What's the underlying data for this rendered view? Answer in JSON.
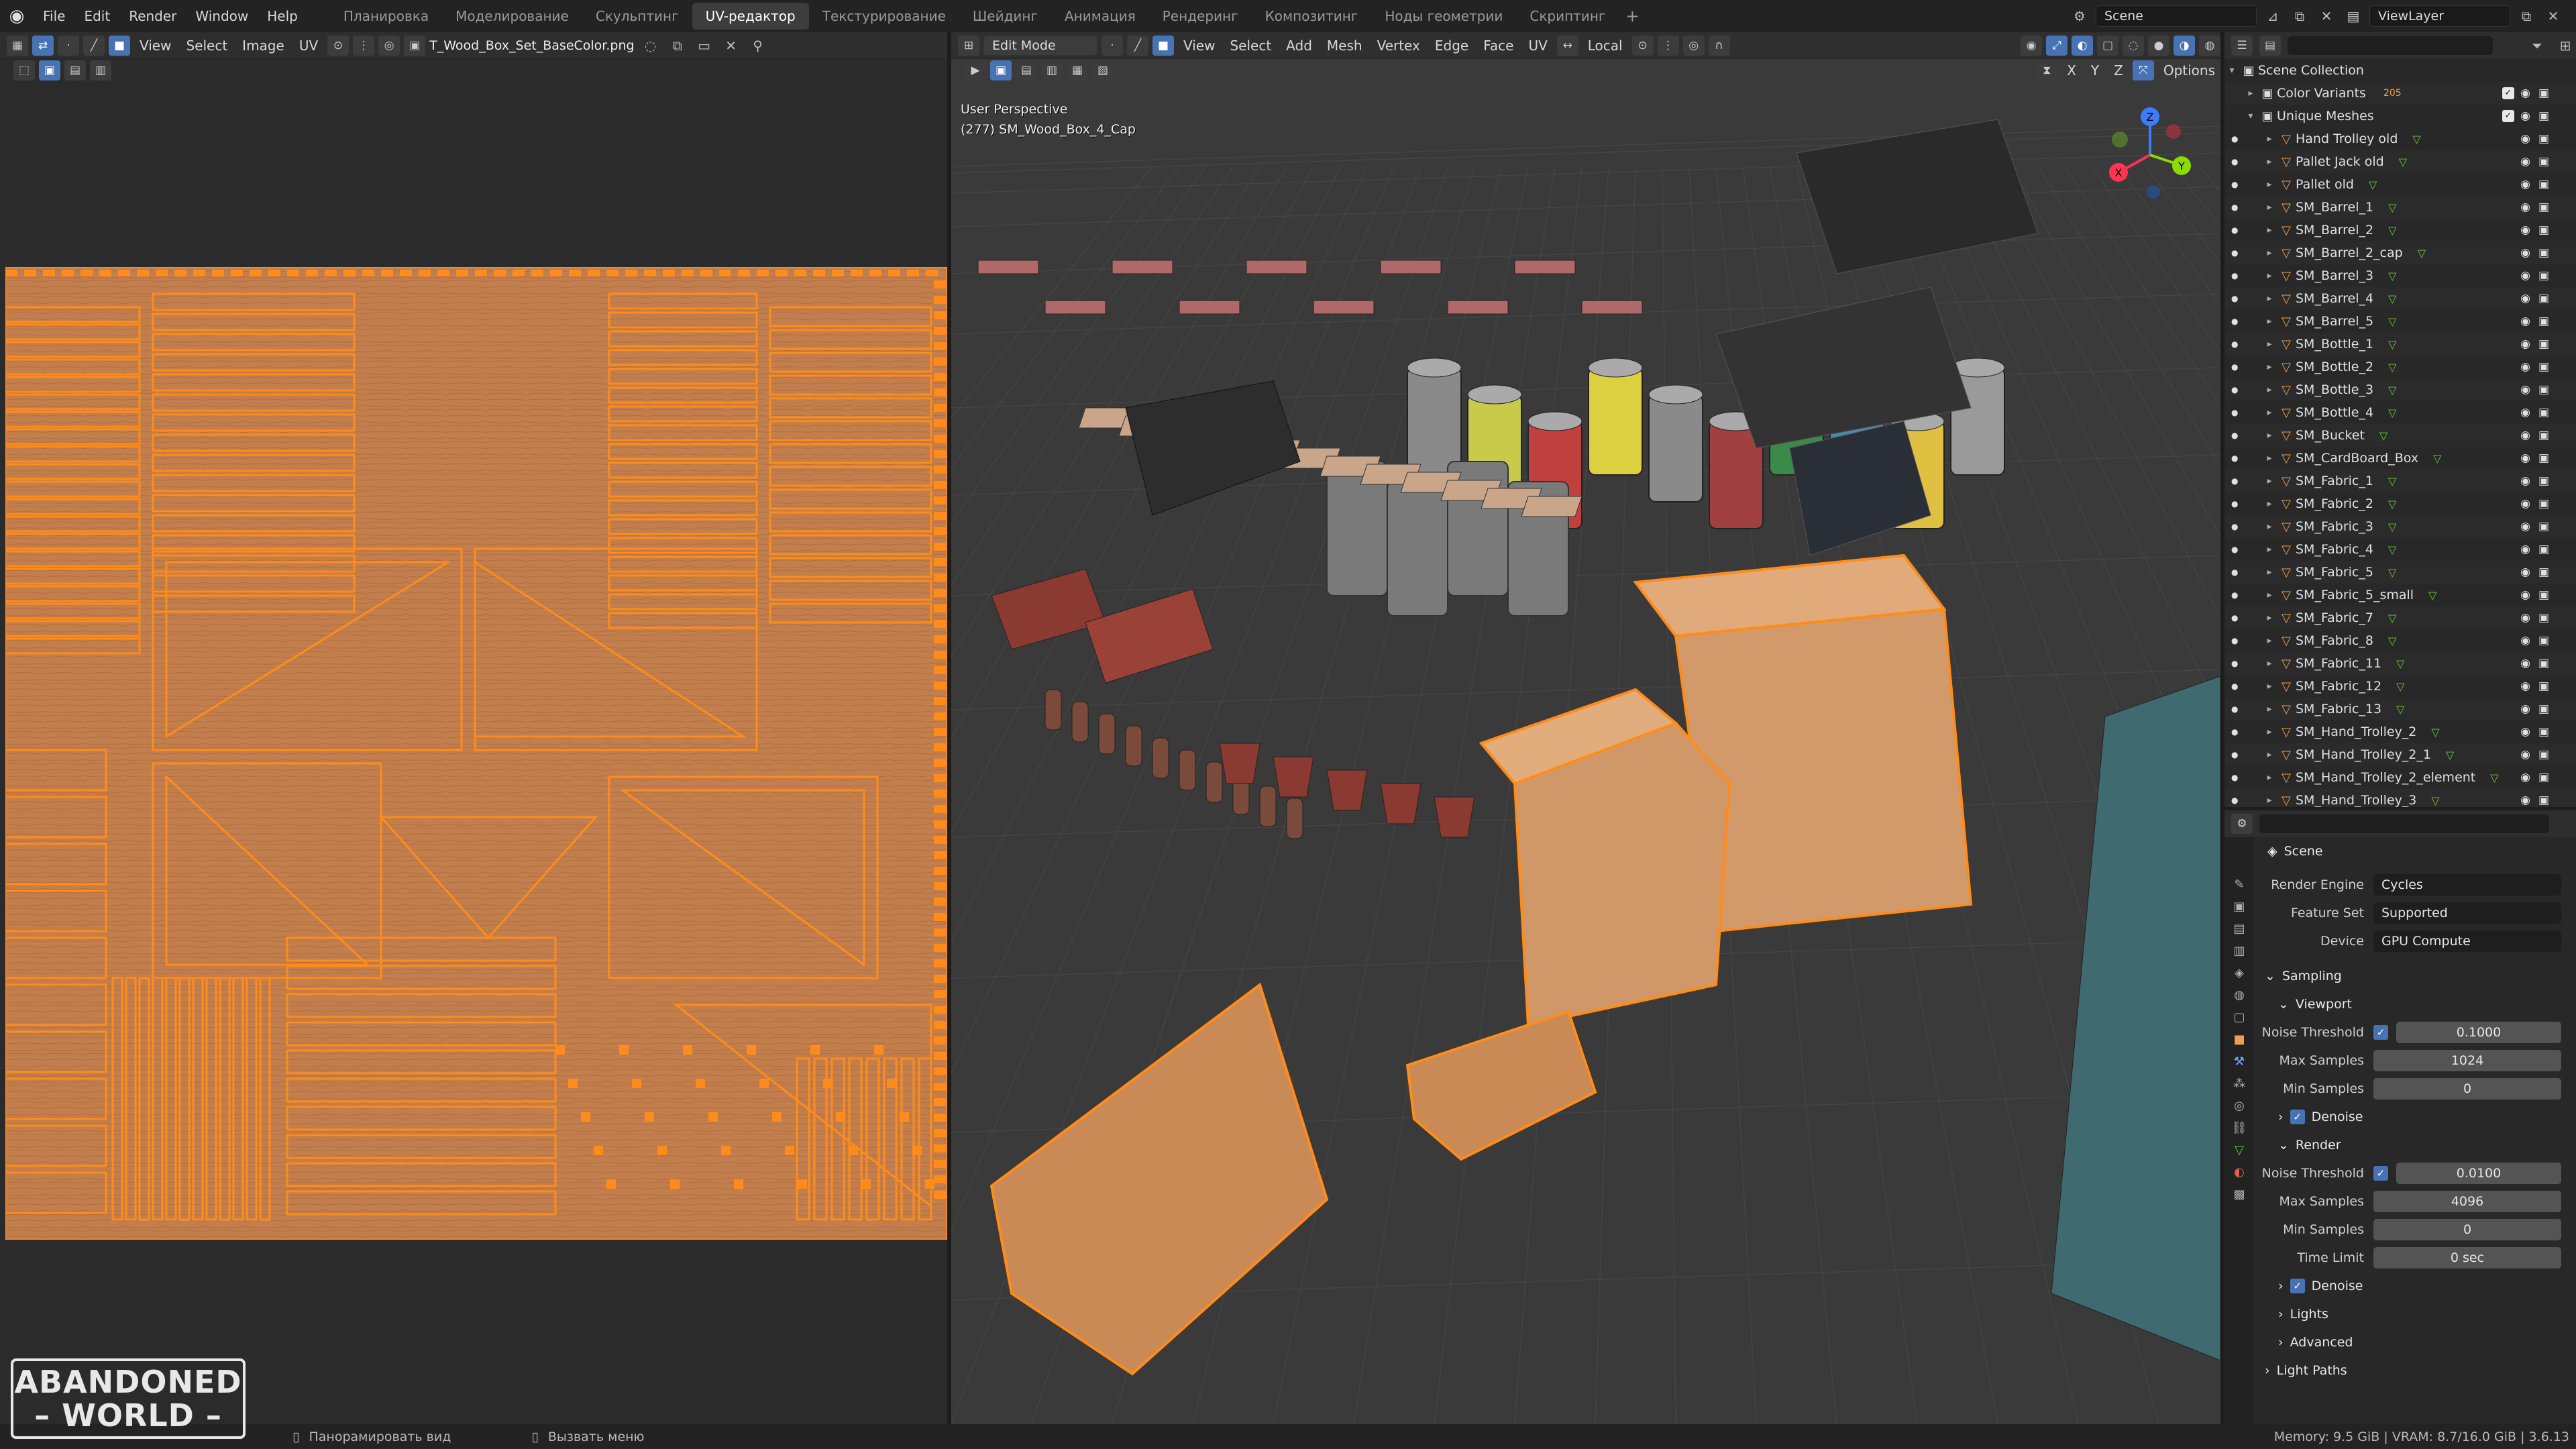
{
  "menu": [
    "File",
    "Edit",
    "Render",
    "Window",
    "Help"
  ],
  "workspace_tabs": [
    {
      "label": "Планировка",
      "active": false
    },
    {
      "label": "Моделирование",
      "active": false
    },
    {
      "label": "Скульптинг",
      "active": false
    },
    {
      "label": "UV-редактор",
      "active": true
    },
    {
      "label": "Текстурирование",
      "active": false
    },
    {
      "label": "Шейдинг",
      "active": false
    },
    {
      "label": "Анимация",
      "active": false
    },
    {
      "label": "Рендеринг",
      "active": false
    },
    {
      "label": "Композитинг",
      "active": false
    },
    {
      "label": "Ноды геометрии",
      "active": false
    },
    {
      "label": "Скриптинг",
      "active": false
    }
  ],
  "topright": {
    "scene": "Scene",
    "viewlayer": "ViewLayer"
  },
  "uv_editor": {
    "menus": [
      "View",
      "Select",
      "Image",
      "UV"
    ],
    "image_name": "T_Wood_Box_Set_BaseColor.png"
  },
  "viewport": {
    "mode": "Edit Mode",
    "menus": [
      "View",
      "Select",
      "Add",
      "Mesh",
      "Vertex",
      "Edge",
      "Face",
      "UV"
    ],
    "orientation": "Local",
    "options_label": "Options",
    "axes_labels": [
      "X",
      "Y",
      "Z"
    ],
    "perspective": "User Perspective",
    "object_info": "(277) SM_Wood_Box_4_Cap"
  },
  "outliner": {
    "root": "Scene Collection",
    "collections": [
      {
        "name": "Color Variants",
        "badge": "205"
      },
      {
        "name": "Unique Meshes",
        "badge": ""
      }
    ],
    "items": [
      "Hand Trolley old",
      "Pallet Jack old",
      "Pallet old",
      "SM_Barrel_1",
      "SM_Barrel_2",
      "SM_Barrel_2_cap",
      "SM_Barrel_3",
      "SM_Barrel_4",
      "SM_Barrel_5",
      "SM_Bottle_1",
      "SM_Bottle_2",
      "SM_Bottle_3",
      "SM_Bottle_4",
      "SM_Bucket",
      "SM_CardBoard_Box",
      "SM_Fabric_1",
      "SM_Fabric_2",
      "SM_Fabric_3",
      "SM_Fabric_4",
      "SM_Fabric_5",
      "SM_Fabric_5_small",
      "SM_Fabric_7",
      "SM_Fabric_8",
      "SM_Fabric_11",
      "SM_Fabric_12",
      "SM_Fabric_13",
      "SM_Hand_Trolley_2",
      "SM_Hand_Trolley_2_1",
      "SM_Hand_Trolley_2_element",
      "SM_Hand_Trolley_3"
    ]
  },
  "properties": {
    "context": "Scene",
    "render_engine": {
      "label": "Render Engine",
      "value": "Cycles"
    },
    "feature_set": {
      "label": "Feature Set",
      "value": "Supported"
    },
    "device": {
      "label": "Device",
      "value": "GPU Compute"
    },
    "sampling": "Sampling",
    "viewport_section": "Viewport",
    "viewport_noise_threshold": {
      "label": "Noise Threshold",
      "value": "0.1000"
    },
    "viewport_max_samples": {
      "label": "Max Samples",
      "value": "1024"
    },
    "viewport_min_samples": {
      "label": "Min Samples",
      "value": "0"
    },
    "denoise_label": "Denoise",
    "render_section": "Render",
    "render_noise_threshold": {
      "label": "Noise Threshold",
      "value": "0.0100"
    },
    "render_max_samples": {
      "label": "Max Samples",
      "value": "4096"
    },
    "render_min_samples": {
      "label": "Min Samples",
      "value": "0"
    },
    "time_limit": {
      "label": "Time Limit",
      "value": "0 sec"
    },
    "lights": "Lights",
    "advanced": "Advanced",
    "light_paths": "Light Paths"
  },
  "statusbar": {
    "pan": "Панорамировать вид",
    "menu": "Вызвать меню",
    "memory": "Memory: 9.5 GiB | VRAM: 8.7/16.0 GiB | 3.6.13"
  },
  "watermark": {
    "line1": "ABANDONED",
    "line2": "WORLD"
  },
  "colors": {
    "accent": "#4772b3",
    "selection": "#ff8c1a",
    "wood": "#c98a55"
  }
}
